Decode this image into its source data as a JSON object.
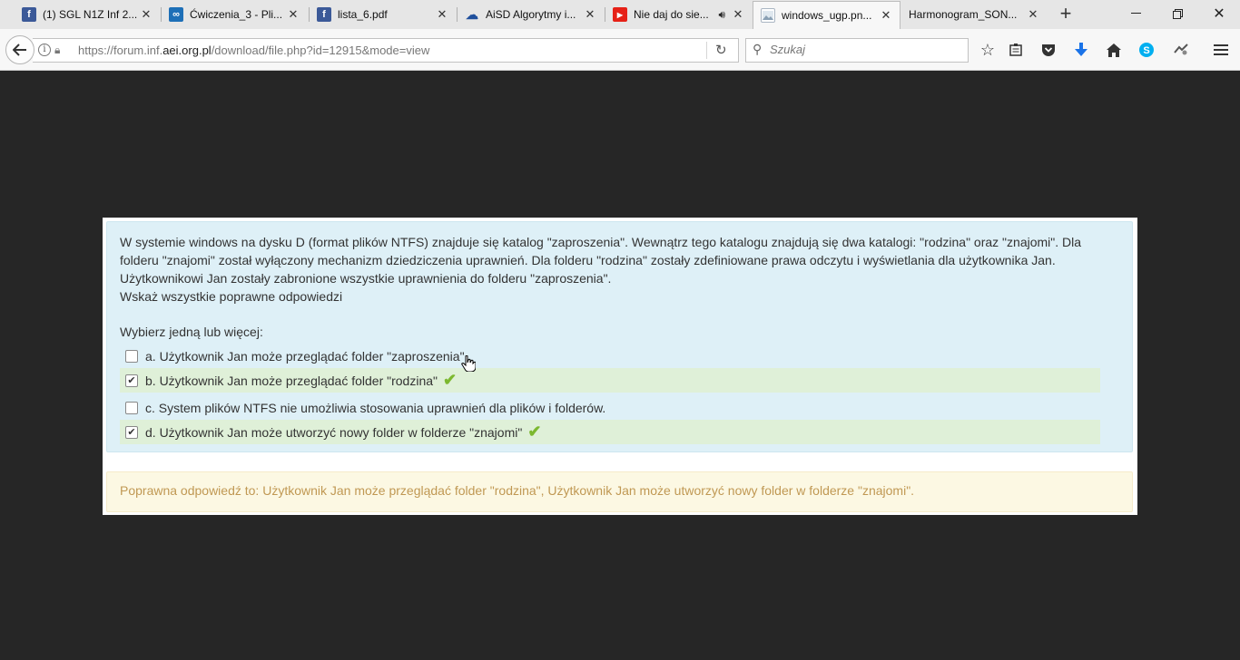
{
  "tabs": [
    {
      "title": "(1) SGL N1Z Inf 2...",
      "icon": "facebook-icon",
      "color": "#3b5998",
      "glyph": "f"
    },
    {
      "title": "Ćwiczenia_3 - Pli...",
      "icon": "owncloud-icon",
      "color": "#1d6fb7",
      "glyph": "∞"
    },
    {
      "title": "lista_6.pdf",
      "icon": "facebook-icon",
      "color": "#3b5998",
      "glyph": "f"
    },
    {
      "title": "AiSD Algorytmy i...",
      "icon": "cloud-icon",
      "color": "#1f4f9c",
      "glyph": "☁"
    },
    {
      "title": "Nie daj do sie...",
      "icon": "youtube-icon",
      "color": "#e62117",
      "glyph": "▶"
    },
    {
      "title": "windows_ugp.pn...",
      "icon": "image-icon",
      "color": "#aab6c3",
      "glyph": ""
    },
    {
      "title": "Harmonogram_SON...",
      "icon": "",
      "color": "",
      "glyph": ""
    }
  ],
  "url": {
    "prefix": "https://forum.inf.",
    "domain": "aei.org.pl",
    "path": "/download/file.php?id=12915&mode=view"
  },
  "search": {
    "placeholder": "Szukaj"
  },
  "question": {
    "text_lines": [
      "W systemie windows na dysku D (format plików NTFS) znajduje się katalog \"zaproszenia\". Wewnątrz tego katalogu znajdują się dwa katalogi: \"rodzina\" oraz \"znajomi\". Dla",
      "folderu \"znajomi\" został wyłączony mechanizm dziedziczenia uprawnień. Dla folderu \"rodzina\" zostały zdefiniowane prawa odczytu i wyświetlania dla użytkownika Jan.",
      "Użytkownikowi Jan zostały zabronione wszystkie uprawnienia do folderu \"zaproszenia\".",
      "Wskaż wszystkie poprawne odpowiedzi"
    ],
    "prompt": "Wybierz jedną lub więcej:",
    "answers": [
      {
        "label": "a. Użytkownik Jan może przeglądać folder \"zaproszenia\".",
        "checked": false,
        "correct": false
      },
      {
        "label": "b. Użytkownik Jan może przeglądać folder \"rodzina\"",
        "checked": true,
        "correct": true
      },
      {
        "label": "c. System plików NTFS nie umożliwia stosowania uprawnień dla plików i folderów.",
        "checked": false,
        "correct": false
      },
      {
        "label": "d. Użytkownik Jan może utworzyć nowy folder w folderze \"znajomi\"",
        "checked": true,
        "correct": true
      }
    ]
  },
  "feedback": "Poprawna odpowiedź to: Użytkownik Jan może przeglądać folder \"rodzina\", Użytkownik Jan może utworzyć nowy folder w folderze \"znajomi\".",
  "colors": {
    "correct_bg": "#dff0d8",
    "question_bg": "#def0f7",
    "feedback_bg": "#fcf8e3",
    "feedback_text": "#c09853",
    "check": "#7cb82f"
  }
}
